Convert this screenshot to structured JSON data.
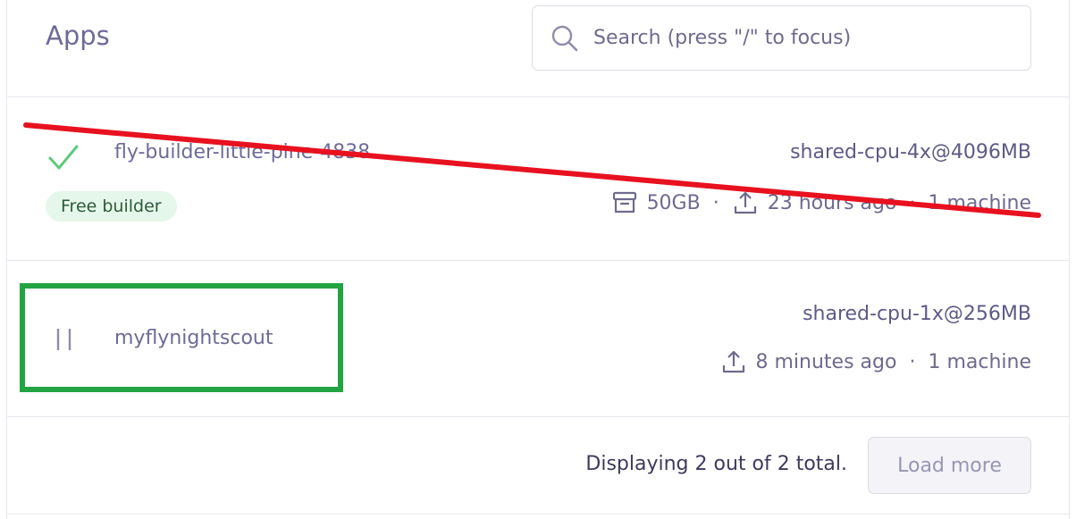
{
  "header": {
    "title": "Apps",
    "search": {
      "placeholder": "Search (press \"/\" to focus)",
      "value": "",
      "icon": "search-icon"
    }
  },
  "apps": [
    {
      "name": "fly-builder-little-pine-4838",
      "status_icon": "check-icon",
      "status_color": "#5dc97a",
      "badge": "Free builder",
      "machine_type": "shared-cpu-4x@4096MB",
      "volume": "50GB",
      "deployed": "23 hours ago",
      "machines": "1 machine",
      "struck_through": true
    },
    {
      "name": "myflynightscout",
      "status_icon": "pause-icon",
      "status_color": "#8f8cab",
      "machine_type": "shared-cpu-1x@256MB",
      "deployed": "8 minutes ago",
      "machines": "1 machine",
      "highlighted": true
    }
  ],
  "separator": "·",
  "footer": {
    "summary": "Displaying 2 out of 2 total.",
    "load_more_label": "Load more"
  },
  "colors": {
    "strike_line": "#e8111f",
    "highlight_box": "#22a442",
    "badge_bg": "#e5f7ea"
  }
}
